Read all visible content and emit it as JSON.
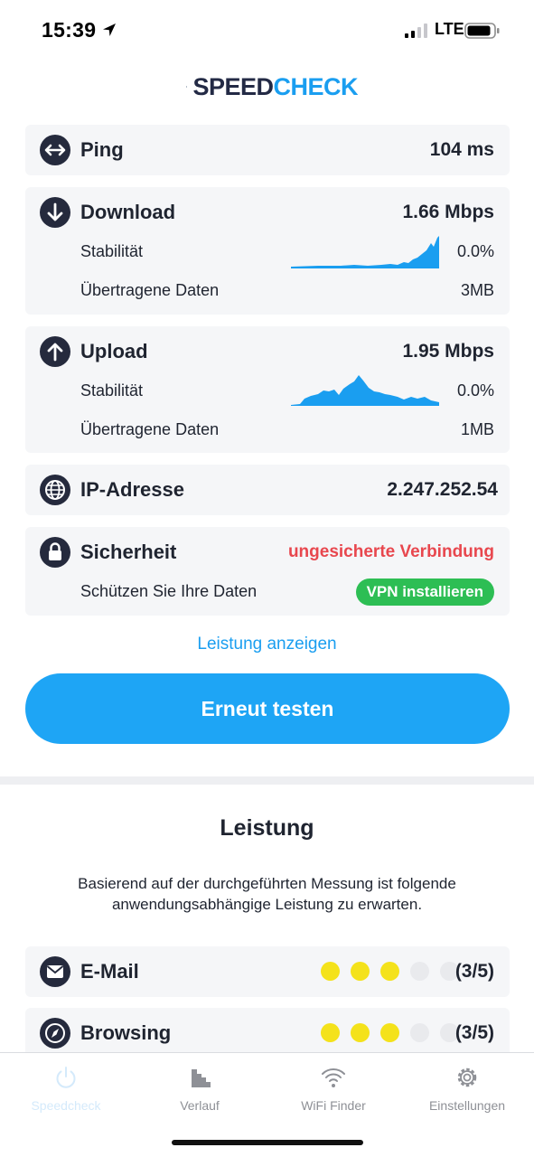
{
  "status_bar": {
    "time": "15:39",
    "network": "LTE"
  },
  "app": {
    "logo_part1": "SPEED",
    "logo_part2": "CHECK",
    "accent": "#1a9ef0",
    "brand_dark": "#232a45"
  },
  "ping": {
    "label": "Ping",
    "value": "104 ms",
    "icon": "double-arrow-icon"
  },
  "download": {
    "label": "Download",
    "value": "1.66 Mbps",
    "icon": "arrow-down-icon",
    "stability_label": "Stabilität",
    "stability_value": "0.0%",
    "data_label": "Übertragene Daten",
    "data_value": "3MB"
  },
  "upload": {
    "label": "Upload",
    "value": "1.95 Mbps",
    "icon": "arrow-up-icon",
    "stability_label": "Stabilität",
    "stability_value": "0.0%",
    "data_label": "Übertragene Daten",
    "data_value": "1MB"
  },
  "ip": {
    "label": "IP-Adresse",
    "value": "2.247.252.54",
    "icon": "globe-icon"
  },
  "security": {
    "label": "Sicherheit",
    "value": "ungesicherte Verbindung",
    "icon": "lock-icon",
    "sub_label": "Schützen Sie Ihre Daten",
    "button": "VPN installieren",
    "warn_color": "#e8474e",
    "button_color": "#2dbe54"
  },
  "show_performance_link": "Leistung anzeigen",
  "retest_button": "Erneut testen",
  "performance": {
    "title": "Leistung",
    "description": "Basierend auf der durchgeführten Messung ist folgende anwendungsabhängige Leistung zu erwarten.",
    "items": [
      {
        "label": "E-Mail",
        "score": 3,
        "max": 5,
        "rating": "(3/5)",
        "icon": "envelope-icon"
      },
      {
        "label": "Browsing",
        "score": 3,
        "max": 5,
        "rating": "(3/5)",
        "icon": "compass-icon"
      }
    ]
  },
  "tabs": [
    {
      "label": "Speedcheck",
      "icon": "power-icon",
      "active": true
    },
    {
      "label": "Verlauf",
      "icon": "bar-chart-icon",
      "active": false
    },
    {
      "label": "WiFi Finder",
      "icon": "wifi-icon",
      "active": false
    },
    {
      "label": "Einstellungen",
      "icon": "gear-icon",
      "active": false
    }
  ]
}
